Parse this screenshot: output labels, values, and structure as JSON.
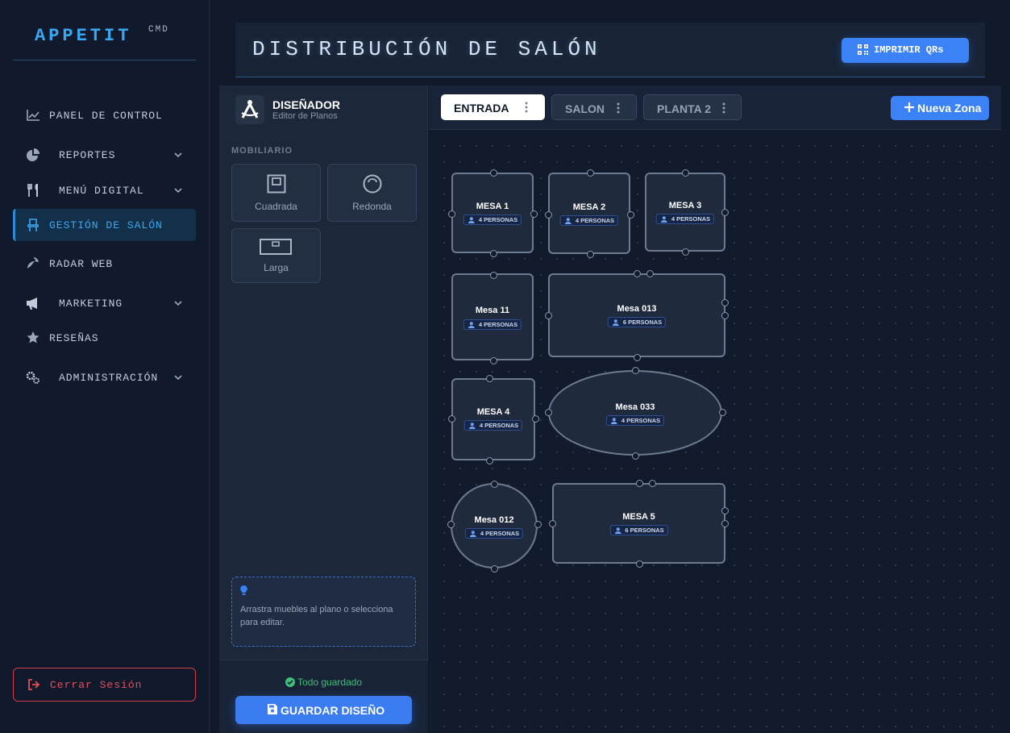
{
  "brand": {
    "name": "APPETIT",
    "sup": "CMD"
  },
  "nav": [
    {
      "label": "PANEL DE CONTROL",
      "icon": "chart-line-icon"
    },
    {
      "label": "REPORTES",
      "icon": "pie-chart-icon"
    },
    {
      "label": "MENÚ DIGITAL",
      "icon": "utensils-icon"
    },
    {
      "label": "GESTIÓN DE SALÓN",
      "icon": "chair-icon",
      "active": true
    },
    {
      "label": "RADAR WEB",
      "icon": "satellite-dish-icon"
    },
    {
      "label": "MARKETING",
      "icon": "megaphone-icon"
    },
    {
      "label": "RESEÑAS",
      "icon": "star-icon"
    },
    {
      "label": "ADMINISTRACIÓN",
      "icon": "gears-icon"
    }
  ],
  "logout": {
    "label": "Cerrar Sesión"
  },
  "header": {
    "title": "DISTRIBUCIÓN DE SALÓN",
    "print_label": "IMPRIMIR QRs"
  },
  "designer": {
    "title": "DISEÑADOR",
    "subtitle": "Editor de Planos",
    "section": "MOBILIARIO",
    "items": [
      "Cuadrada",
      "Redonda",
      "Larga"
    ],
    "tip": "Arrastra muebles al plano o selecciona para editar.",
    "status": "Todo guardado",
    "save_label": "GUARDAR DISEÑO"
  },
  "zones": {
    "tabs": [
      "ENTRADA",
      "SALON",
      "PLANTA 2"
    ],
    "active": "ENTRADA",
    "new_label": "Nueva Zona"
  },
  "tables": [
    {
      "name": "MESA 1",
      "capacity": "4 PERSONAS",
      "shape": "square"
    },
    {
      "name": "MESA 2",
      "capacity": "4 PERSONAS",
      "shape": "square"
    },
    {
      "name": "MESA 3",
      "capacity": "4 PERSONAS",
      "shape": "square"
    },
    {
      "name": "Mesa 11",
      "capacity": "4 PERSONAS",
      "shape": "square"
    },
    {
      "name": "Mesa 013",
      "capacity": "6 PERSONAS",
      "shape": "long"
    },
    {
      "name": "MESA 4",
      "capacity": "4 PERSONAS",
      "shape": "square"
    },
    {
      "name": "Mesa 033",
      "capacity": "4 PERSONAS",
      "shape": "oval"
    },
    {
      "name": "Mesa 012",
      "capacity": "4 PERSONAS",
      "shape": "round"
    },
    {
      "name": "MESA 5",
      "capacity": "6 PERSONAS",
      "shape": "long"
    }
  ],
  "colors": {
    "accent": "#3b82f6",
    "active_nav": "#3ea6ee",
    "danger": "#e0505b",
    "success": "#3fbf7a"
  }
}
